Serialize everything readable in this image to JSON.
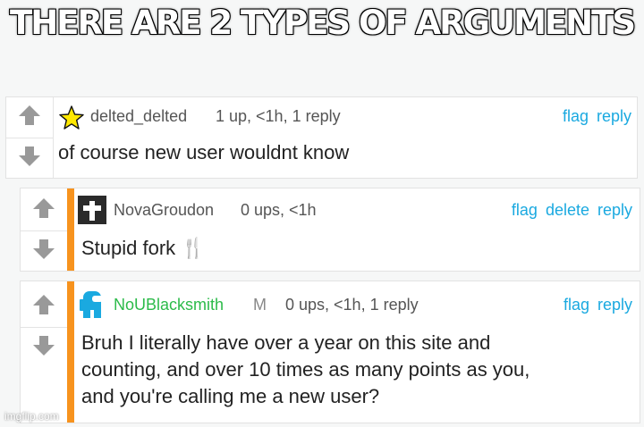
{
  "meme_title": "THERE ARE 2 TYPES OF ARGUMENTS",
  "accent_color": "#f7931e",
  "link_color": "#1aa9e0",
  "comments": [
    {
      "username": "delted_delted",
      "avatar_icon": "star-icon",
      "meta": "1 up, <1h, 1 reply",
      "actions": [
        "flag",
        "reply"
      ],
      "body": "of course new user wouldnt know"
    },
    {
      "username": "NovaGroudon",
      "avatar_icon": "cross-avatar-icon",
      "meta": "0 ups, <1h",
      "actions": [
        "flag",
        "delete",
        "reply"
      ],
      "body": "Stupid fork 🍴"
    },
    {
      "username": "NoUBlacksmith",
      "avatar_icon": "crewmate-avatar-icon",
      "badge": "M",
      "meta": "0 ups, <1h, 1 reply",
      "actions": [
        "flag",
        "reply"
      ],
      "body_lines": [
        "Bruh I literally have over a year on this site and",
        "counting, and over 10 times as many points as you,",
        "and you're calling me a new user?"
      ]
    }
  ],
  "watermark": "imgflip.com"
}
